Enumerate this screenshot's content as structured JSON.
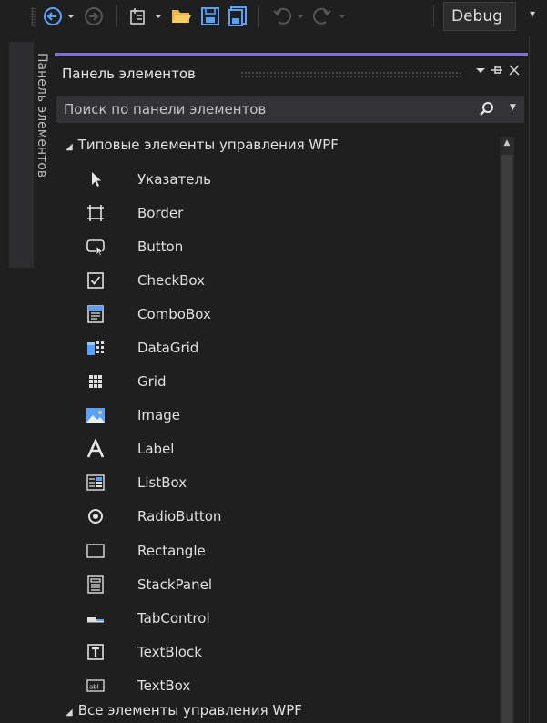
{
  "toolbar": {
    "config_value": "Debug"
  },
  "side_tab": {
    "label": "Панель элементов"
  },
  "panel": {
    "title": "Панель элементов",
    "search_placeholder": "Поиск по панели элементов",
    "accent_color": "#7d6fd4"
  },
  "groups": {
    "wpf_common": "Типовые элементы управления WPF",
    "wpf_all": "Все элементы управления WPF"
  },
  "items": [
    {
      "label": "Указатель",
      "icon": "pointer-icon"
    },
    {
      "label": "Border",
      "icon": "border-icon"
    },
    {
      "label": "Button",
      "icon": "button-icon"
    },
    {
      "label": "CheckBox",
      "icon": "checkbox-icon"
    },
    {
      "label": "ComboBox",
      "icon": "combobox-icon"
    },
    {
      "label": "DataGrid",
      "icon": "datagrid-icon"
    },
    {
      "label": "Grid",
      "icon": "grid-icon"
    },
    {
      "label": "Image",
      "icon": "image-icon"
    },
    {
      "label": "Label",
      "icon": "label-icon"
    },
    {
      "label": "ListBox",
      "icon": "listbox-icon"
    },
    {
      "label": "RadioButton",
      "icon": "radiobutton-icon"
    },
    {
      "label": "Rectangle",
      "icon": "rectangle-icon"
    },
    {
      "label": "StackPanel",
      "icon": "stackpanel-icon"
    },
    {
      "label": "TabControl",
      "icon": "tabcontrol-icon"
    },
    {
      "label": "TextBlock",
      "icon": "textblock-icon"
    },
    {
      "label": "TextBox",
      "icon": "textbox-icon"
    }
  ]
}
